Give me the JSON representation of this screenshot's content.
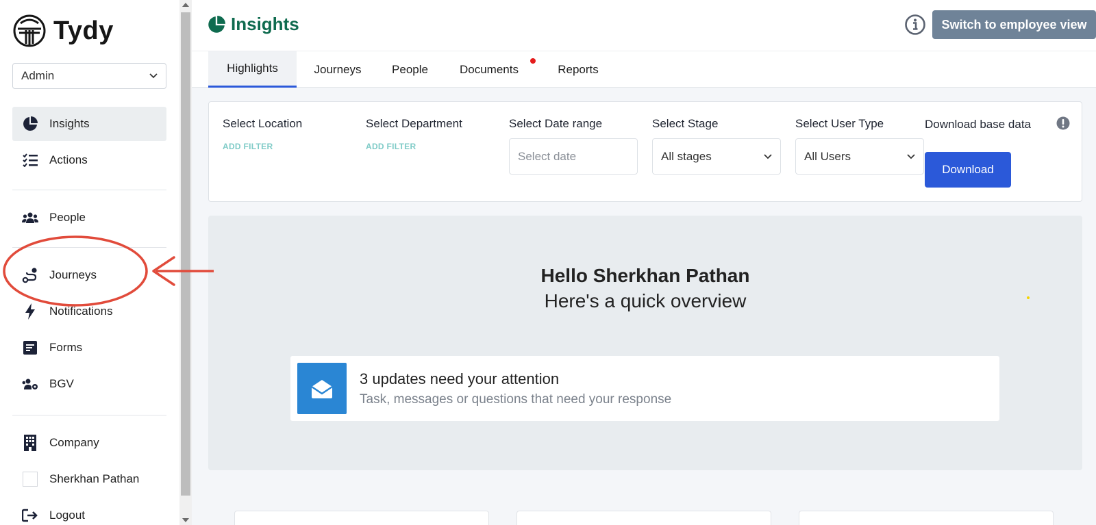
{
  "brand": {
    "name": "Tydy"
  },
  "role_select": {
    "value": "Admin"
  },
  "sidebar": {
    "items": [
      {
        "label": "Insights",
        "icon": "pie-chart-icon",
        "active": true
      },
      {
        "label": "Actions",
        "icon": "checklist-icon"
      },
      {
        "label": "People",
        "icon": "users-icon"
      },
      {
        "label": "Journeys",
        "icon": "route-icon"
      },
      {
        "label": "Notifications",
        "icon": "bolt-icon"
      },
      {
        "label": "Forms",
        "icon": "form-icon"
      },
      {
        "label": "BGV",
        "icon": "users-cog-icon"
      },
      {
        "label": "Company",
        "icon": "building-icon"
      },
      {
        "label": "Sherkhan Pathan",
        "icon": "avatar"
      },
      {
        "label": "Logout",
        "icon": "logout-icon"
      }
    ]
  },
  "header": {
    "title": "Insights",
    "switch_label": "Switch to employee view"
  },
  "tabs": [
    {
      "label": "Highlights",
      "active": true
    },
    {
      "label": "Journeys"
    },
    {
      "label": "People"
    },
    {
      "label": "Documents",
      "has_badge": true
    },
    {
      "label": "Reports"
    }
  ],
  "filters": {
    "location_label": "Select Location",
    "location_action": "ADD FILTER",
    "department_label": "Select Department",
    "department_action": "ADD FILTER",
    "date_label": "Select Date range",
    "date_placeholder": "Select date",
    "stage_label": "Select Stage",
    "stage_value": "All stages",
    "usertype_label": "Select User Type",
    "usertype_value": "All Users",
    "download_label": "Download base data",
    "download_button": "Download"
  },
  "overview": {
    "greeting": "Hello Sherkhan Pathan",
    "subtitle": "Here's a quick overview",
    "update_title": "3 updates need your attention",
    "update_subtitle": "Task, messages or questions that need your response"
  },
  "colors": {
    "brand_green": "#0f6b4f",
    "primary_blue": "#2b59d9",
    "switch_gray": "#6f8398",
    "badge_red": "#e41c1c",
    "annotation_red": "#e14b3b",
    "update_icon_blue": "#2a86d4",
    "add_filter_teal": "#7fcbc7"
  }
}
